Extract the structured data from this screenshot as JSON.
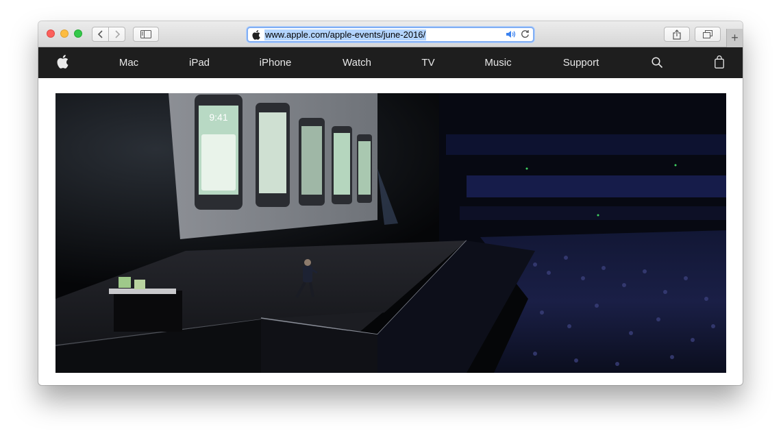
{
  "browser": {
    "url": "www.apple.com/apple-events/june-2016/",
    "icons": {
      "back": "chevron-left-icon",
      "forward": "chevron-right-icon",
      "sidebar": "sidebar-icon",
      "share": "share-icon",
      "tabs": "tabs-overview-icon",
      "new_tab": "plus-icon",
      "audio": "speaker-icon",
      "reload": "reload-icon",
      "site": "apple-logo-icon"
    },
    "new_tab_label": "+"
  },
  "nav": {
    "items": [
      "Mac",
      "iPad",
      "iPhone",
      "Watch",
      "TV",
      "Music",
      "Support"
    ],
    "icons": {
      "logo": "apple-logo-icon",
      "search": "search-icon",
      "bag": "shopping-bag-icon"
    }
  },
  "hero": {
    "screen_time": "9:41"
  },
  "colors": {
    "nav_background": "#1e1e1e",
    "nav_text": "#e8e8e8",
    "url_focus": "#80aef4",
    "url_selection": "#b3d4fd"
  }
}
